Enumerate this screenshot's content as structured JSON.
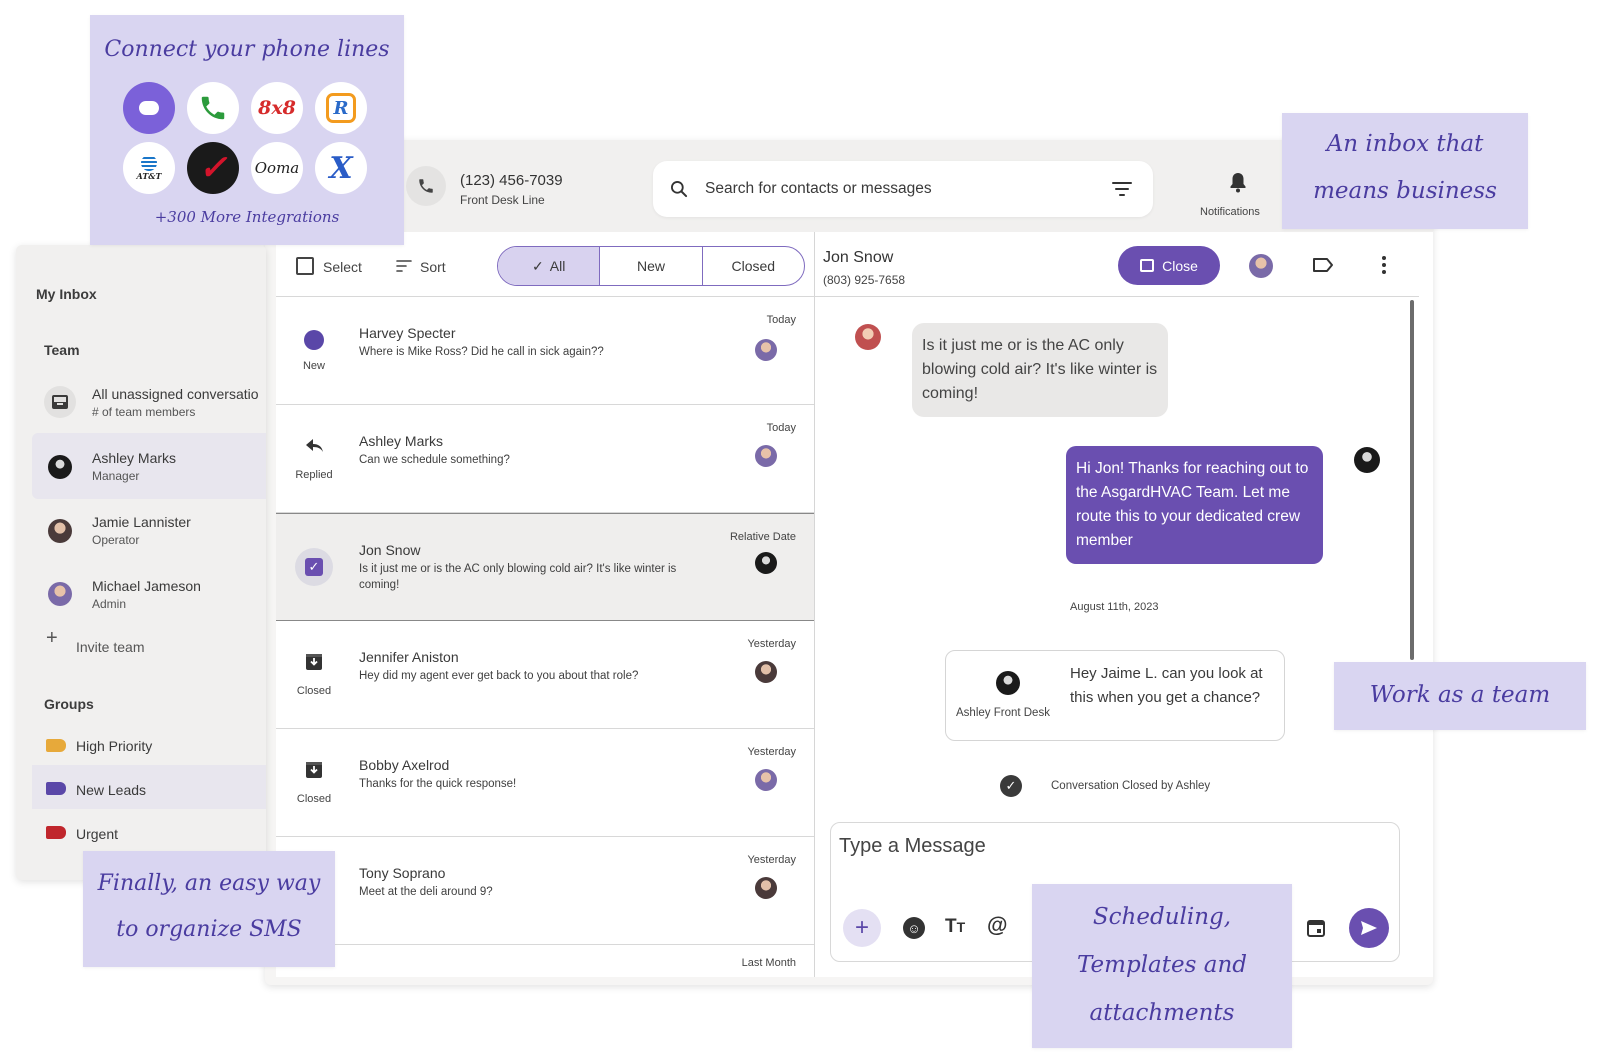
{
  "header": {
    "phone_number": "(123) 456-7039",
    "phone_label": "Front Desk Line",
    "search_placeholder": "Search for contacts or messages",
    "notifications_label": "Notifications"
  },
  "callouts": {
    "connect_title": "Connect your phone lines",
    "integrations_more": "+300 More Integrations",
    "inbox_line1": "An inbox that",
    "inbox_line2": "means business",
    "team": "Work as a team",
    "organize_line1": "Finally, an easy way",
    "organize_line2": "to organize SMS",
    "scheduling_line1": "Scheduling,",
    "scheduling_line2": "Templates and",
    "scheduling_line3": "attachments"
  },
  "integrations": [
    {
      "name": "dialpad-logo",
      "text": "",
      "bg": "#7b61d9",
      "fg": "#ffffff"
    },
    {
      "name": "phone-logo",
      "text": "📞",
      "bg": "#ffffff",
      "fg": "#2c9b3c"
    },
    {
      "name": "8x8-logo",
      "text": "8x8",
      "bg": "#ffffff",
      "fg": "#d62b2b"
    },
    {
      "name": "ringcentral-logo",
      "text": "R",
      "bg": "#ffffff",
      "fg": "#2a6ac9"
    },
    {
      "name": "att-logo",
      "text": "AT&T",
      "bg": "#ffffff",
      "fg": "#1a76c9"
    },
    {
      "name": "verizon-logo",
      "text": "✓",
      "bg": "#1a1a1a",
      "fg": "#d4142b"
    },
    {
      "name": "ooma-logo",
      "text": "Ooma",
      "bg": "#ffffff",
      "fg": "#222222"
    },
    {
      "name": "xfinity-logo",
      "text": "X",
      "bg": "#ffffff",
      "fg": "#2a5cc7"
    }
  ],
  "sidebar": {
    "my_inbox": "My Inbox",
    "team_heading": "Team",
    "unassigned_title": "All unassigned conversatio",
    "unassigned_sub": "# of team members",
    "members": [
      {
        "name": "Ashley Marks",
        "role": "Manager"
      },
      {
        "name": "Jamie Lannister",
        "role": "Operator"
      },
      {
        "name": "Michael Jameson",
        "role": "Admin"
      }
    ],
    "invite": "Invite team",
    "groups_heading": "Groups",
    "groups": [
      {
        "label": "High Priority",
        "color": "#e7a93a"
      },
      {
        "label": "New Leads",
        "color": "#5a47a8"
      },
      {
        "label": "Urgent",
        "color": "#c0262c"
      }
    ]
  },
  "list_toolbar": {
    "select": "Select",
    "sort": "Sort",
    "tabs": [
      "All",
      "New",
      "Closed"
    ]
  },
  "conversations": [
    {
      "name": "Harvey Specter",
      "message": "Where is Mike Ross? Did he call in sick again??",
      "date": "Today",
      "status": "New"
    },
    {
      "name": "Ashley Marks",
      "message": "Can we schedule something?",
      "date": "Today",
      "status": "Replied"
    },
    {
      "name": "Jon Snow",
      "message": "Is it just me or is the AC only blowing cold air? It's like winter is coming!",
      "date": "Relative Date",
      "status": ""
    },
    {
      "name": "Jennifer Aniston",
      "message": "Hey did my agent ever get back to you about that role?",
      "date": "Yesterday",
      "status": "Closed"
    },
    {
      "name": "Bobby Axelrod",
      "message": "Thanks for the quick response!",
      "date": "Yesterday",
      "status": "Closed"
    },
    {
      "name": "Tony Soprano",
      "message": "Meet at the deli around 9?",
      "date": "Yesterday",
      "status": ""
    }
  ],
  "last_month": "Last Month",
  "chat": {
    "contact_name": "Jon Snow",
    "contact_phone": "(803) 925-7658",
    "close_label": "Close",
    "incoming_message": "Is it just me or is the AC only blowing cold air? It's like winter is coming!",
    "outgoing_message": "Hi Jon! Thanks for reaching out to the AsgardHVAC Team. Let me route this to your dedicated crew member",
    "date_divider": "August 11th, 2023",
    "note_author": "Ashley Front Desk",
    "note_text": "Hey Jaime L. can you look at this when you get a chance?",
    "closed_notice": "Conversation Closed by Ashley",
    "composer_placeholder": "Type a Message"
  },
  "colors": {
    "accent": "#6a4fb0",
    "callout_bg": "#d9d5f1",
    "callout_text": "#4a3ca0"
  }
}
